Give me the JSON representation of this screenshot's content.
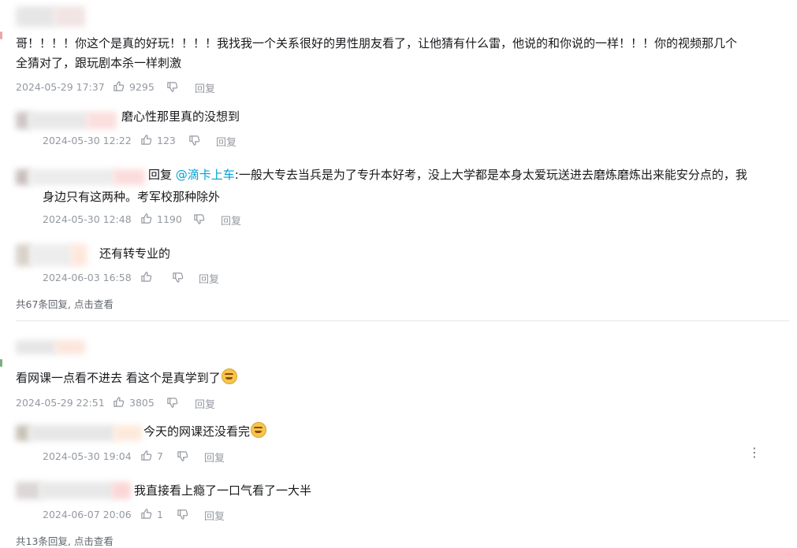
{
  "threads": [
    {
      "main": {
        "text": "哥！！！！你这个是真的好玩！！！！我找我一个关系很好的男性朋友看了，让他猜有什么雷，他说的和你说的一样！！！你的视频那几个",
        "text2": "全猜对了，跟玩剧本杀一样刺激",
        "date": "2024-05-29 17:37",
        "likes": "9295",
        "reply": "回复"
      },
      "replies": [
        {
          "text": "磨心性那里真的没想到",
          "date": "2024-05-30 12:22",
          "likes": "123",
          "reply": "回复"
        },
        {
          "prefix": "回复 ",
          "mention": "@滴卡上车",
          "text": ":一般大专去当兵是为了专升本好考，没上大学都是本身太爱玩送进去磨炼磨炼出来能安分点的，我",
          "text2": "身边只有这两种。考军校那种除外",
          "date": "2024-05-30 12:48",
          "likes": "1190",
          "reply": "回复"
        },
        {
          "text": "还有转专业的",
          "date": "2024-06-03 16:58",
          "likes": "",
          "reply": "回复"
        }
      ],
      "more": "共67条回复, 点击查看"
    },
    {
      "main": {
        "text": "看网课一点看不进去 看这个是真学到了",
        "date": "2024-05-29 22:51",
        "likes": "3805",
        "reply": "回复"
      },
      "replies": [
        {
          "text": "今天的网课还没看完",
          "date": "2024-05-30 19:04",
          "likes": "7",
          "reply": "回复"
        },
        {
          "text": "我直接看上瘾了一口气看了一大半",
          "date": "2024-06-07 20:06",
          "likes": "1",
          "reply": "回复"
        }
      ],
      "more": "共13条回复, 点击查看"
    }
  ],
  "icons": {
    "like": "thumbs-up-icon",
    "dislike": "thumbs-down-icon",
    "more": "more-vertical-icon",
    "emoji": "laughing-emoji"
  },
  "colors": {
    "mention": "#00a1d6",
    "meta": "#9499a0",
    "text": "#18191c"
  }
}
